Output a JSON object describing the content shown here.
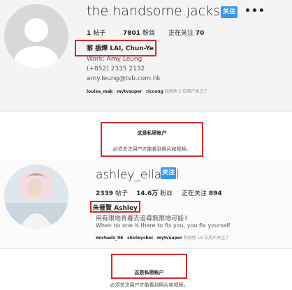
{
  "profile1": {
    "username": "the.handsome.jackson",
    "follow_label": "关注",
    "more_label": "•••",
    "posts_count": "1",
    "posts_label": "帖子",
    "followers_count": "7801",
    "followers_label": "粉丝",
    "following_label": "正在关注",
    "following_count": "70",
    "full_name": "黎 振燁 LAI, Chun-Ye",
    "bio_lines": [
      "Work: Amy Leung",
      "(+852) 2335 2132",
      "amy.leung@tvb.com.hk"
    ],
    "followed_by": {
      "users": [
        "louisa_mak",
        "mytvsuper",
        "riccong"
      ],
      "suffix": "和其他 2 位用户关注了"
    },
    "private_title": "这是私密帐户",
    "private_desc": "必须关注用户才能看到照片和视频。"
  },
  "profile2": {
    "username": "ashley_ellabel",
    "follow_label": "关注",
    "posts_count": "2339",
    "posts_label": "帖子",
    "followers_count": "14.6万",
    "followers_label": "粉丝",
    "following_label": "正在关注",
    "following_count": "894",
    "full_name": "朱晉賢 Ashley",
    "bio_lines": [
      "用有限地青春去追尋無限地可能✌",
      "When no one is there to fix you, you fix yourself"
    ],
    "followed_by": {
      "users": [
        "mlchadz_96",
        "shirleychoi",
        "mytvsuper"
      ],
      "suffix": "和其他 16 位用户关注了"
    },
    "private_title": "这是私密帐户",
    "private_desc": "必须关注用户才能看到照片和视频。"
  },
  "colors": {
    "accent": "#3897f0",
    "highlight_box": "#d42a2a"
  },
  "icons": [
    "default-avatar-icon",
    "more-options-icon"
  ]
}
